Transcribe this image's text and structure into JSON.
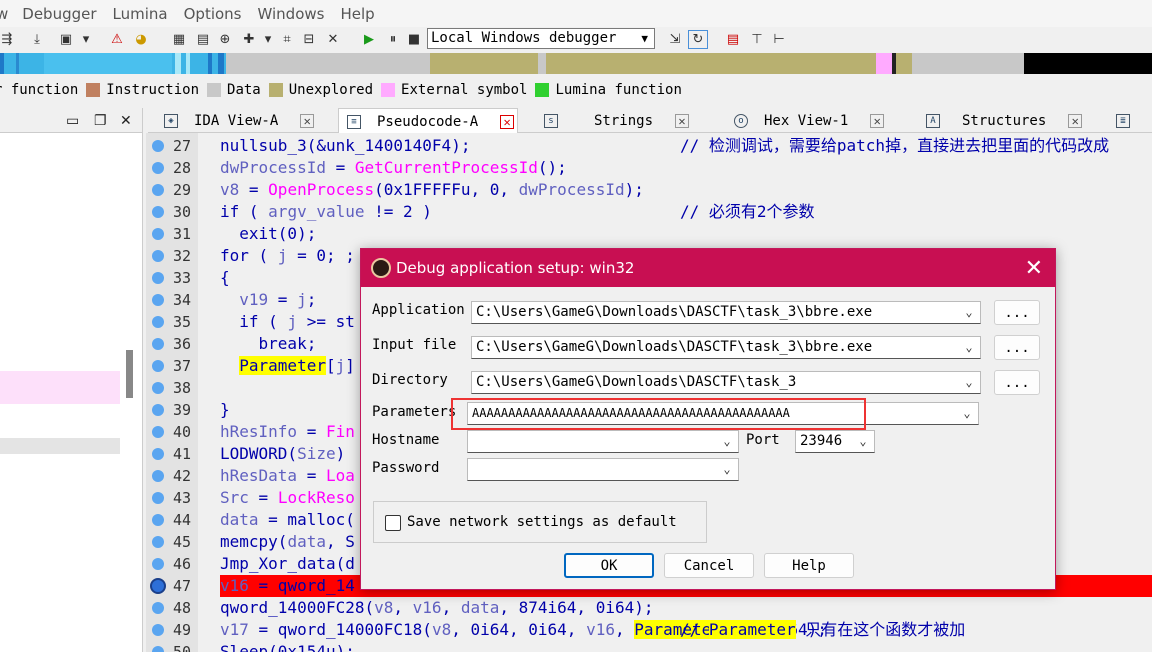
{
  "menu": [
    "w",
    "Debugger",
    "Lumina",
    "Options",
    "Windows",
    "Help"
  ],
  "toolbar": {
    "debugger_value": "Local Windows debugger"
  },
  "legend": [
    {
      "label": "r function",
      "color": "#3cb4e6"
    },
    {
      "label": "Instruction",
      "color": "#c08060"
    },
    {
      "label": "Data",
      "color": "#c8c8c8"
    },
    {
      "label": "Unexplored",
      "color": "#b8b070"
    },
    {
      "label": "External symbol",
      "color": "#ffaaff"
    },
    {
      "label": "Lumina function",
      "color": "#30d030"
    }
  ],
  "tabs": [
    {
      "label": "IDA View-A",
      "icon": "graph-icon"
    },
    {
      "label": "Pseudocode-A",
      "icon": "document-icon"
    },
    {
      "label": "Strings",
      "icon": "strings-icon"
    },
    {
      "label": "Hex View-1",
      "icon": "hex-icon"
    },
    {
      "label": "Structures",
      "icon": "structures-icon"
    },
    {
      "label": "",
      "icon": "enums-icon"
    }
  ],
  "code_lines": [
    {
      "num": "27",
      "text": "nullsub_3(&unk_1400140F4);",
      "comment": "// 检测调试，需要给patch掉，直接进去把里面的代码改成"
    },
    {
      "num": "28",
      "text": "dwProcessId = GetCurrentProcessId();",
      "comment": ""
    },
    {
      "num": "29",
      "text": "v8 = OpenProcess(0x1FFFFFu, 0, dwProcessId);",
      "comment": ""
    },
    {
      "num": "30",
      "text": "if ( argv_value != 2 )",
      "comment": "// 必须有2个参数"
    },
    {
      "num": "31",
      "text": "  exit(0);",
      "comment": ""
    },
    {
      "num": "32",
      "text": "for ( j = 0; ;",
      "comment": ""
    },
    {
      "num": "33",
      "text": "{",
      "comment": ""
    },
    {
      "num": "34",
      "text": "  v19 = j;",
      "comment": ""
    },
    {
      "num": "35",
      "text": "  if ( j >= st",
      "comment": ""
    },
    {
      "num": "36",
      "text": "    break;",
      "comment": ""
    },
    {
      "num": "37",
      "text": "  Parameter[j]",
      "comment": ""
    },
    {
      "num": "38",
      "text": "",
      "comment": ""
    },
    {
      "num": "39",
      "text": "}",
      "comment": ""
    },
    {
      "num": "40",
      "text": "hResInfo = Fin",
      "comment": ""
    },
    {
      "num": "41",
      "text": "LODWORD(Size)",
      "comment": ""
    },
    {
      "num": "42",
      "text": "hResData = Loa",
      "comment": ""
    },
    {
      "num": "43",
      "text": "Src = LockReso",
      "comment": ""
    },
    {
      "num": "44",
      "text": "data = malloc(",
      "comment": ""
    },
    {
      "num": "45",
      "text": "memcpy(data, S",
      "comment": ""
    },
    {
      "num": "46",
      "text": "Jmp_Xor_data(d",
      "comment": ""
    },
    {
      "num": "47",
      "text": "v16 = qword_14",
      "comment": ""
    },
    {
      "num": "48",
      "text": "qword_14000FC28(v8, v16, data, 874i64, 0i64);",
      "comment": ""
    },
    {
      "num": "49",
      "text": "v17 = qword_14000FC18(v8, 0i64, 0i64, v16, Parameter, 0, 0i64);",
      "comment": "// Parameter 只有在这个函数才被加"
    },
    {
      "num": "50",
      "text": "Sleep(0x154u);",
      "comment": ""
    }
  ],
  "dialog": {
    "title": "Debug application setup: win32",
    "application_label": "Application",
    "application_value": "C:\\Users\\GameG\\Downloads\\DASCTF\\task_3\\bbre.exe",
    "input_file_label": "Input file",
    "input_file_value": "C:\\Users\\GameG\\Downloads\\DASCTF\\task_3\\bbre.exe",
    "directory_label": "Directory",
    "directory_value": "C:\\Users\\GameG\\Downloads\\DASCTF\\task_3",
    "parameters_label": "Parameters",
    "parameters_value": "AAAAAAAAAAAAAAAAAAAAAAAAAAAAAAAAAAAAAAAAAAAA",
    "hostname_label": "Hostname",
    "hostname_value": "",
    "port_label": "Port",
    "port_value": "23946",
    "password_label": "Password",
    "password_value": "",
    "browse_label": "...",
    "save_network_label": "Save network settings as default",
    "ok_label": "OK",
    "cancel_label": "Cancel",
    "help_label": "Help",
    "close_label": "✕"
  }
}
